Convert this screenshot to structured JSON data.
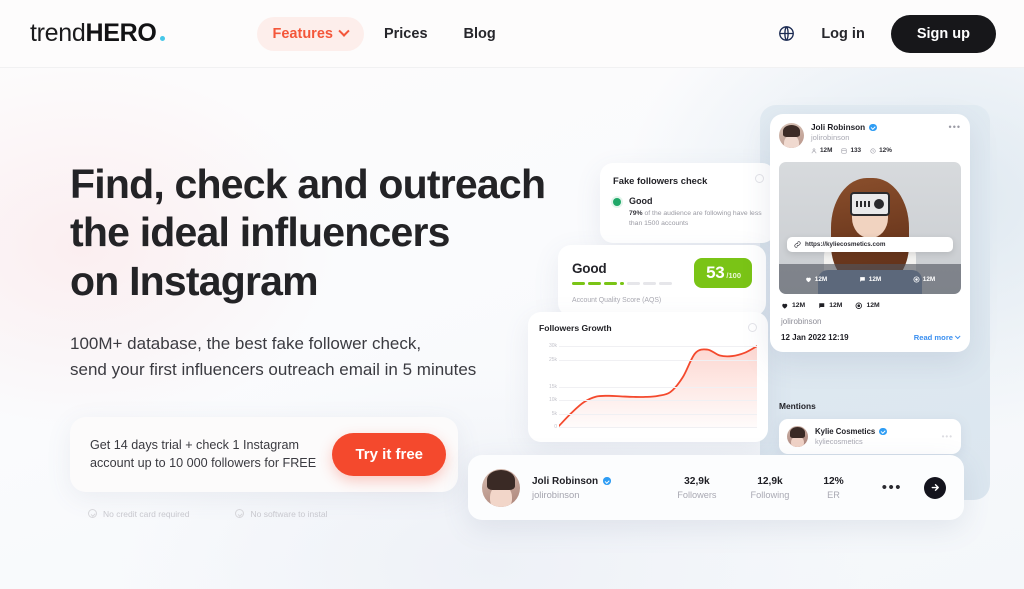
{
  "header": {
    "logo": {
      "part1": "trend",
      "part2": "HERO",
      "dot": "logo-dot"
    },
    "nav": [
      {
        "label": "Features",
        "active": true,
        "icon": "chevron-down-icon"
      },
      {
        "label": "Prices",
        "active": false
      },
      {
        "label": "Blog",
        "active": false
      }
    ],
    "language_icon": "globe-icon",
    "login_label": "Log in",
    "signup_label": "Sign up",
    "accent_color": "#f4563a",
    "signup_bg": "#17171a"
  },
  "hero": {
    "headline_line1": "Find, check and outreach",
    "headline_line2": "the ideal influencers",
    "headline_line3": "on Instagram",
    "sub_line1": "100M+ database, the best fake follower check,",
    "sub_line2": "send your first influencers outreach email in 5 minutes",
    "cta": {
      "text_line1": "Get 14 days trial + check 1 Instagram",
      "text_line2": "account up to 10 000 followers for FREE",
      "button_label": "Try it free",
      "button_color": "#f4492d"
    },
    "notes": [
      {
        "label": "No credit card required",
        "icon": "check-circle-icon"
      },
      {
        "label": "No software to instal",
        "icon": "check-circle-icon"
      }
    ]
  },
  "fake_followers_card": {
    "title": "Fake followers check",
    "status": "Good",
    "status_color": "#1fa868",
    "desc_bold": "79%",
    "desc_rest": " of the audience are following have less than 1500 accounts",
    "info_icon": "question-circle-icon"
  },
  "aqs_card": {
    "rating": "Good",
    "score": "53",
    "denominator": "/100",
    "label": "Account Quality Score (AQS)",
    "badge_color": "#7ac416",
    "dashes_filled": 4,
    "dashes_total": 8
  },
  "chart_data": {
    "type": "area",
    "title": "Followers Growth",
    "xlabel": "",
    "ylabel": "",
    "ylim": [
      0,
      32000
    ],
    "grid": true,
    "legend": "none",
    "line_color": "#f4492d",
    "fill_color": "rgba(244,73,45,0.14)",
    "ytick_labels": [
      "30k",
      "25k",
      "15k",
      "10k",
      "5k",
      "0"
    ],
    "ytick_values": [
      30000,
      25000,
      15000,
      10000,
      5000,
      0
    ],
    "x": [
      0,
      1,
      2,
      3,
      4,
      5,
      6,
      7,
      8,
      9,
      10,
      11,
      12,
      13,
      14,
      15,
      16
    ],
    "values": [
      400,
      5200,
      9200,
      11300,
      11600,
      11400,
      11200,
      11200,
      11600,
      13000,
      18500,
      27400,
      28800,
      26600,
      26400,
      27600,
      30100
    ]
  },
  "instagram_post": {
    "account": {
      "name": "Joli Robinson",
      "handle": "jolirobinson",
      "verified": true
    },
    "stats": [
      {
        "icon": "user-icon",
        "value": "12M"
      },
      {
        "icon": "grid-icon",
        "value": "133"
      },
      {
        "icon": "clock-icon",
        "value": "12%"
      }
    ],
    "menu_icon": "more-horizontal-icon",
    "photo_alt": "woman-with-camera-photo",
    "link": {
      "icon": "link-icon",
      "url": "https://kyliecosmetics.com"
    },
    "overlay_metrics": [
      {
        "icon": "heart-icon",
        "value": "12M"
      },
      {
        "icon": "comment-icon",
        "value": "12M"
      },
      {
        "icon": "eye-icon",
        "value": "12M"
      }
    ],
    "metrics": [
      {
        "icon": "heart-icon",
        "value": "12M"
      },
      {
        "icon": "comment-icon",
        "value": "12M"
      },
      {
        "icon": "eye-icon",
        "value": "12M"
      }
    ],
    "author_handle": "jolirobinson",
    "date": "12 Jan 2022 12:19",
    "read_more": "Read more"
  },
  "mentions": {
    "title": "Mentions",
    "items": [
      {
        "name": "Kylie Cosmetics",
        "handle": "kyliecosmetics",
        "verified": true,
        "menu_icon": "more-horizontal-icon"
      }
    ]
  },
  "profile_bar": {
    "name": "Joli Robinson",
    "handle": "jolirobinson",
    "verified": true,
    "stats": [
      {
        "value": "32,9k",
        "label": "Followers"
      },
      {
        "value": "12,9k",
        "label": "Following"
      },
      {
        "value": "12%",
        "label": "ER"
      }
    ],
    "menu_icon": "more-horizontal-icon",
    "go_icon": "arrow-right-circle-icon"
  }
}
